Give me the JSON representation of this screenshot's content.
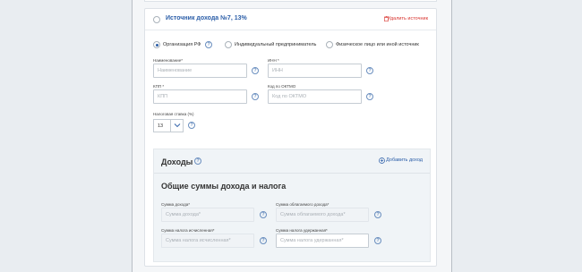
{
  "source": {
    "title": "Источник дохода №7, 13%",
    "delete_label": "Удалить источник"
  },
  "payer_types": [
    {
      "label": "Организация РФ",
      "selected": true
    },
    {
      "label": "Индивидуальный предприниматель",
      "selected": false
    },
    {
      "label": "Физическое лицо или иной источник",
      "selected": false
    }
  ],
  "fields": {
    "name": {
      "label": "Наименование*",
      "placeholder": "Наименование"
    },
    "inn": {
      "label": "ИНН *",
      "placeholder": "ИНН"
    },
    "kpp": {
      "label": "КПП *",
      "placeholder": "КПП"
    },
    "oktmo": {
      "label": "Код по ОКТМО",
      "placeholder": "Код по ОКТМО"
    },
    "tax_rate": {
      "label": "Налоговая ставка (%)",
      "value": "13"
    }
  },
  "income": {
    "title": "Доходы",
    "add_label": "Добавить доход",
    "totals_title": "Общие суммы дохода и налога",
    "income_sum": {
      "label": "Сумма дохода*",
      "placeholder": "Сумма дохода*"
    },
    "taxable_sum": {
      "label": "Сумма облагаемого дохода*",
      "placeholder": "Сумма облагаемого дохода*"
    },
    "tax_calc": {
      "label": "Сумма налога исчисленная*",
      "placeholder": "Сумма налога исчисленная*"
    },
    "tax_withheld": {
      "label": "Сумма налога удержанная*",
      "placeholder": "Сумма налога удержанная*"
    }
  },
  "help_glyph": "?",
  "colors": {
    "accent": "#2b5ea8",
    "danger": "#d8342f"
  }
}
